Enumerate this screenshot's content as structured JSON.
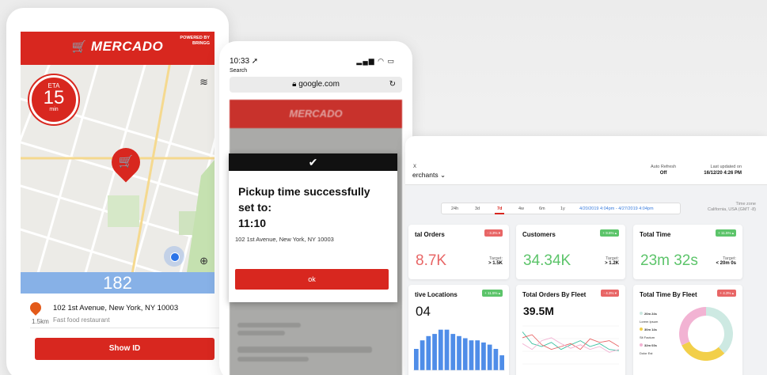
{
  "phone1": {
    "brand": "MERCADO",
    "powered_by": "POWERED BY",
    "powered_by_brand": "BRINGG",
    "eta_label": "ETA",
    "eta_value": "15",
    "eta_unit": "min",
    "counter": "182",
    "address": "102 1st Avenue, New York, NY 10003",
    "distance": "1.5km",
    "place_type": "Fast food restaurant",
    "show_id_label": "Show ID"
  },
  "phone2": {
    "time": "10:33 ➚",
    "back_label": "Search",
    "url": "google.com",
    "blur_brand": "MERCADO",
    "modal": {
      "check": "✔",
      "title": "Pickup time successfully set to:",
      "time": "11:10",
      "address": "102 1st Avenue, New York, NY 10003",
      "ok_label": "ok"
    }
  },
  "dashboard": {
    "close": "X",
    "view": "erchants ⌄",
    "auto_refresh_label": "Auto Refresh",
    "auto_refresh_value": "Off",
    "last_updated_label": "Last updated on",
    "last_updated_value": "16/12/20 4:26 PM",
    "ranges": [
      "24h",
      "3d",
      "7d",
      "4w",
      "6m",
      "1y"
    ],
    "selected_range": "7d",
    "date_range": "4/20/2019 4:04pm - 4/27/2019 4:04pm",
    "timezone_label": "Time zone",
    "timezone_value": "California, USA (GMT -8)",
    "cards": {
      "orders": {
        "title": "tal Orders",
        "badge": "- 3.3% ▾",
        "value": "8.7K",
        "target_label": "Target:",
        "target_value": "> 1.5K"
      },
      "customers": {
        "title": "Customers",
        "badge": "+ 9.6% ▴",
        "value": "34.34K",
        "target_label": "Target:",
        "target_value": "> 1.2K"
      },
      "time": {
        "title": "Total Time",
        "badge": "+ 11.5% ▴",
        "value": "23m 32s",
        "target_label": "Target:",
        "target_value": "< 20m 0s"
      },
      "locations": {
        "title": "tive Locations",
        "badge": "+ 11.5% ▴",
        "value": "04"
      },
      "fleet_orders": {
        "title": "Total Orders By Fleet",
        "badge": "- 4.3% ▾",
        "value": "39.5M"
      },
      "fleet_time": {
        "title": "Total Time By Fleet",
        "badge": "+ 4.3% ▴",
        "legend": [
          {
            "label": "20m 24s",
            "sub": "Lorem Ipsum",
            "color": "#cde9e2"
          },
          {
            "label": "30m 14s",
            "sub": "Sit Factum",
            "color": "#f2cf4a"
          },
          {
            "label": "32m 03s",
            "sub": "Dolor Est",
            "color": "#f2b3d3"
          }
        ]
      }
    },
    "chart_data": [
      {
        "type": "bar",
        "values": [
          10,
          14,
          16,
          17,
          19,
          19,
          17,
          16,
          15,
          14,
          14,
          13,
          12,
          10,
          7
        ],
        "color": "#4f8de8"
      },
      {
        "type": "line",
        "series": [
          {
            "values": [
              60,
              40,
              35,
              42,
              30,
              38,
              45,
              35,
              40,
              30,
              28
            ],
            "color": "#3dc1a2"
          },
          {
            "values": [
              50,
              55,
              38,
              30,
              35,
              40,
              30,
              48,
              42,
              45,
              35
            ],
            "color": "#e86666"
          },
          {
            "values": [
              40,
              30,
              45,
              50,
              40,
              32,
              38,
              30,
              35,
              25,
              30
            ],
            "color": "#f2b3d3"
          }
        ]
      },
      {
        "type": "pie",
        "series": [
          {
            "values": [
              38,
              30,
              32
            ],
            "colors": [
              "#cde9e2",
              "#f2cf4a",
              "#f2b3d3"
            ]
          }
        ]
      }
    ]
  }
}
